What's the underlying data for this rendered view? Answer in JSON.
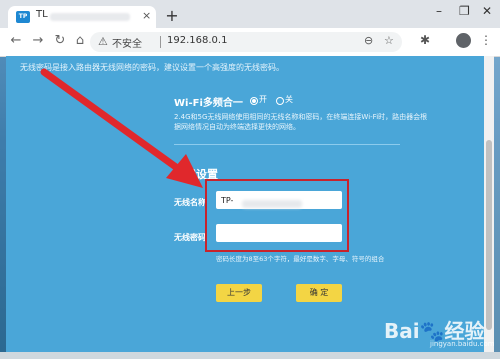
{
  "browser": {
    "tab_favicon_text": "TP",
    "tab_title": "TL",
    "tab_close": "×",
    "new_tab": "+",
    "minimize": "–",
    "maximize": "❐",
    "close": "✕",
    "insecure_label": "不安全",
    "url": "192.168.0.1"
  },
  "page": {
    "top_hint": "无线密码是接入路由器无线网络的密码，建议设置一个高强度的无线密码。",
    "wifi_merge_label": "Wi-Fi多频合一",
    "radio_on_label": "开",
    "radio_off_label": "关",
    "wifi_merge_desc": "2.4G和5G无线网络使用相同的无线名称和密码，在终端连接Wi-Fi时，路由器会根据网络情况自动为终端选择更快的网络。",
    "section_title": "无线设置",
    "ssid_label": "无线名称",
    "ssid_value": "TP-",
    "password_label": "无线密码",
    "password_value": "",
    "password_hint": "密码长度为8至63个字符，最好是数字、字母、符号的组合",
    "prev_button": "上一步",
    "confirm_button": "确 定"
  },
  "watermark": {
    "text": "Bai🐾经验",
    "sub": "jingyan.baidu.com"
  },
  "colors": {
    "page_bg": "#4aa6d8",
    "button_yellow": "#f3d544",
    "highlight_red": "#c8232c",
    "arrow_red": "#e0282c"
  }
}
